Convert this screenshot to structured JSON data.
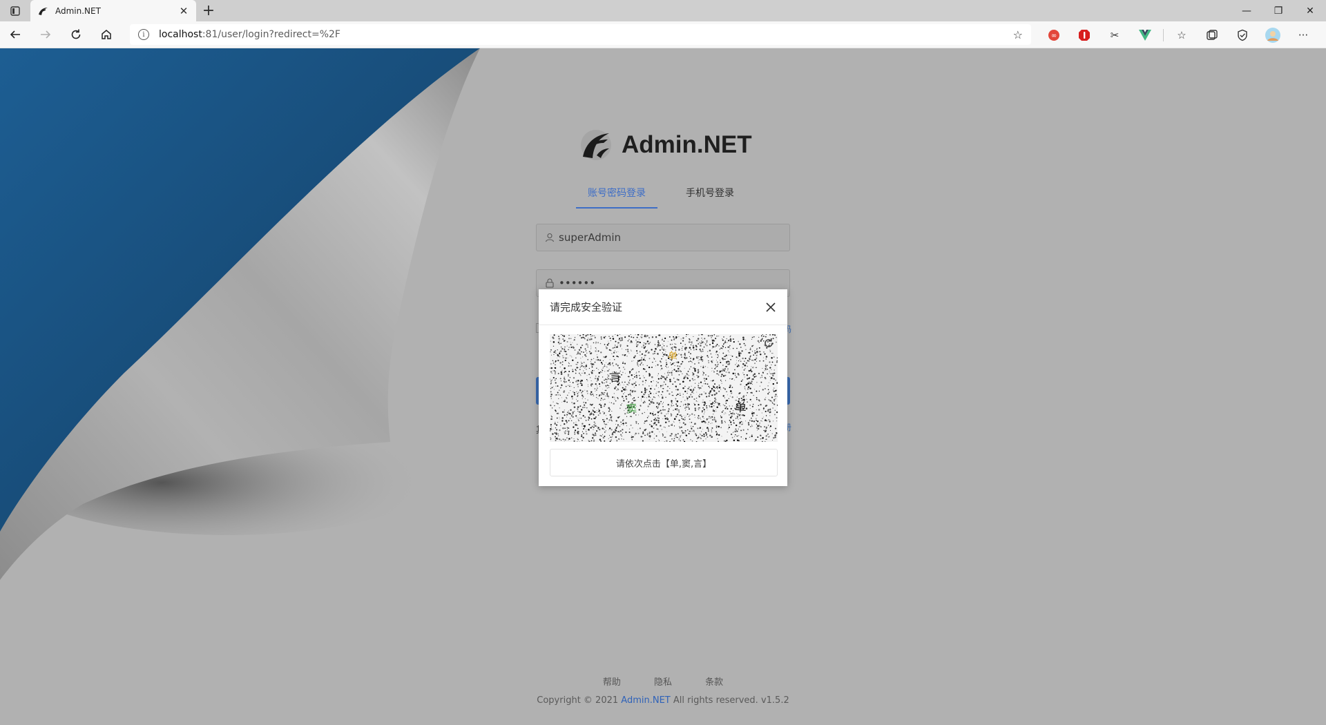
{
  "browser": {
    "tab_title": "Admin.NET",
    "url_host": "localhost",
    "url_rest": ":81/user/login?redirect=%2F",
    "window_controls": [
      "minimize",
      "restore",
      "close"
    ],
    "extensions": [
      "infinity-extension-icon",
      "adblock-extension-icon",
      "scissors-extension-icon",
      "vue-devtools-icon",
      "favorites-icon",
      "collections-icon",
      "shield-icon",
      "profile-avatar",
      "more-icon"
    ]
  },
  "brand": {
    "name": "Admin.NET"
  },
  "login": {
    "tabs": [
      "账号密码登录",
      "手机号登录"
    ],
    "active_tab": 0,
    "username": "superAdmin",
    "password_mask": "••••••"
  },
  "captcha_modal": {
    "title": "请完成安全验证",
    "chars": [
      {
        "text": "言",
        "color": "#1a1a1a"
      },
      {
        "text": "单",
        "color": "#d9a21e"
      },
      {
        "text": "窦",
        "color": "#3b9a3b"
      },
      {
        "text": "单",
        "color": "#111111"
      }
    ],
    "prompt": "请依次点击【单,窦,言】"
  },
  "footer": {
    "links": [
      "帮助",
      "隐私",
      "条款"
    ],
    "copyright_prefix": "Copyright © 2021 ",
    "copyright_brand": "Admin.NET",
    "copyright_suffix": " All rights reserved. v1.5.2"
  },
  "colors": {
    "accent": "#3d6dc6",
    "overlay_bg": "#b1b1b1",
    "page_curl_blue": "#1a5a8c"
  }
}
